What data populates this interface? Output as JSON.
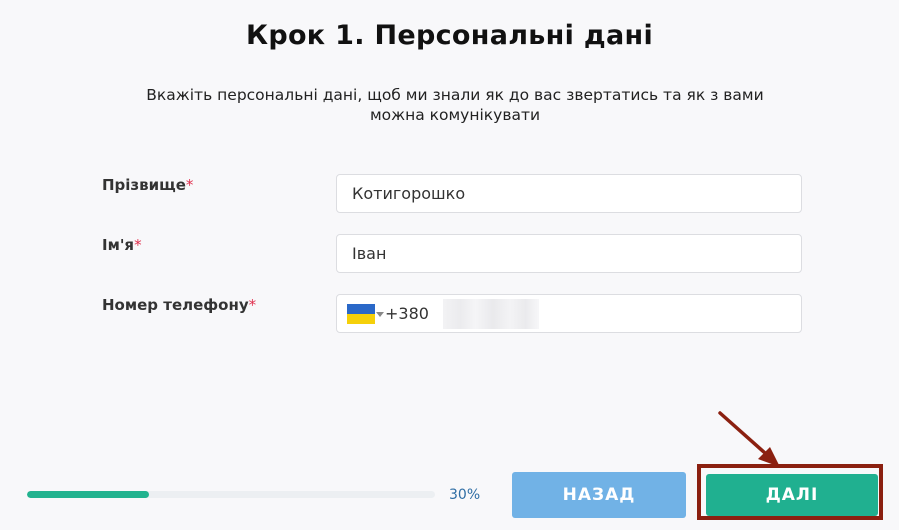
{
  "page": {
    "title": "Крок 1. Персональні дані",
    "subtitle": "Вкажіть персональні дані, щоб ми знали як до вас звертатись та як з вами можна комунікувати"
  },
  "form": {
    "surname": {
      "label": "Прізвище",
      "required_mark": "*",
      "value": "Котигорошко"
    },
    "name": {
      "label": "Ім'я",
      "required_mark": "*",
      "value": "Іван"
    },
    "phone": {
      "label": "Номер телефону",
      "required_mark": "*",
      "country_icon": "ukraine-flag-icon",
      "country_code": "+380"
    }
  },
  "progress": {
    "percent": 30,
    "label": "30%"
  },
  "buttons": {
    "back_label": "НАЗАД",
    "next_label": "ДАЛІ"
  },
  "colors": {
    "accent_green": "#20b090",
    "back_blue": "#71b2e6",
    "required_red": "#e0304e",
    "annotation": "#8b2010"
  }
}
